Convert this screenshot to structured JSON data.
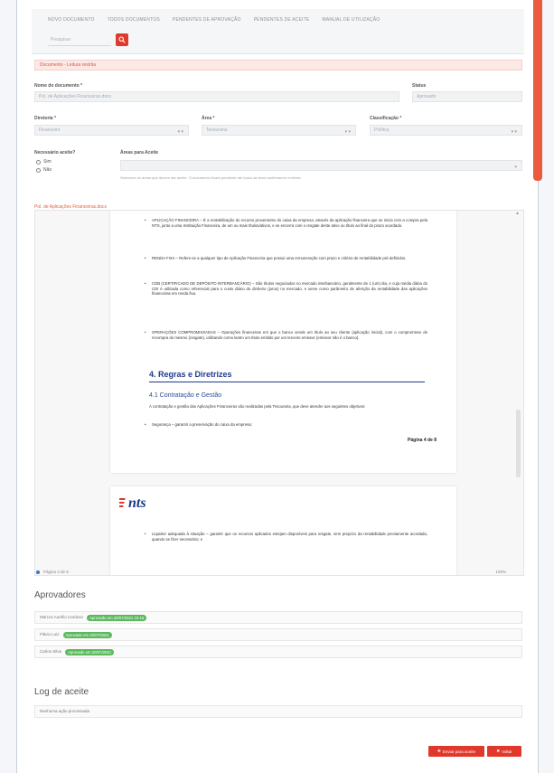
{
  "topnav": {
    "tabs": [
      "Novo documento",
      "Todos documentos",
      "Pendentes de aprovação",
      "Pendentes de aceite",
      "Manual de utilização"
    ],
    "search_placeholder": "Pesquisar"
  },
  "alert": "Documento - Leitura restrita",
  "form": {
    "doc_name_label": "Nome do documento *",
    "doc_name_value": "Pol. de Aplicações Financeiras.docx",
    "status_label": "Status",
    "status_value": "Aprovado",
    "diretoria_label": "Diretoria *",
    "diretoria_value": "Financeiro",
    "area_label": "Área *",
    "area_value": "Tesouraria",
    "class_label": "Classificação *",
    "class_value": "Política",
    "aceite_label": "Necessário aceite?",
    "sim_label": "Sim",
    "nao_label": "Não",
    "areas_aceite_label": "Áreas para Aceite",
    "hint": "Selecione as áreas que devem dar aceite. O documento ficará pendente até todos da área confirmarem a leitura."
  },
  "document": {
    "file_link": "Pol. de Aplicações Financeiras.docx",
    "bullets_p1": [
      "APLICAÇÃO FINANCEIRA – É a rentabilização do recurso proveniente do caixa da empresa, através da aplicação financeira que se inicia com a compra pela NTS, junto a uma Instituição Financeira, de um ou mais títulos/ativos, e se encerra com o resgate deste ativo ou título ao final do prazo acordado.",
      "RENDA FIXA – Refere-se a qualquer tipo de Aplicação Financeira que possui uma remuneração com prazo e critério de rentabilidade pré-definidos.",
      "CDB (CERTIFICADO DE DEPÓSITO INTERBANCÁRIO) – São títulos negociados no mercado interbancário, geralmente de 1 (um) dia, e cuja média diária do CDI é utilizada como referencial para o custo diário do dinheiro (juros) no mercado, e serve como parâmetro de aferição da rentabilidade das aplicações financeiras em renda fixa.",
      "OPERAÇÕES COMPROMISSADAS – Operações financeiras em que o banco vende um título ao seu cliente (aplicação inicial), com o compromisso de recompra do mesmo (resgate), utilizando como lastro um título emitido por um terceiro emissor (emissor não é o banco)."
    ],
    "heading": "4. Regras e Diretrizes",
    "subheading": "4.1 Contratação e Gestão",
    "para": "A contratação e gestão das Aplicações Financeiras são realizadas pela Tesouraria, que deve atender aos seguintes objetivos:",
    "bullet_short": "Segurança – garantir a preservação do caixa da empresa;",
    "page_num": "Página 4 de 8",
    "logo_text": "nts",
    "bullet_p2": "Liquidez adequada à situação – garantir que os recursos aplicados estejam disponíveis para resgate, sem prejuízo da rentabilidade previamente acordada, quando se fizer necessário; e"
  },
  "viewer_toolbar": {
    "left": "Página 4 de 8",
    "right": "100%"
  },
  "aprovadores": {
    "title": "Aprovadores",
    "rows": [
      {
        "name": "Marcos Aurélio Cardoso",
        "badge": "Aprovado em 20/07/2021 10:15"
      },
      {
        "name": "Flávio Luiz",
        "badge": "Aprovado em 20/07/2021"
      },
      {
        "name": "Carlos Silva",
        "badge": "Aprovado em 20/07/2021"
      }
    ]
  },
  "log": {
    "title": "Log de aceite",
    "empty": "Nenhuma ação processada"
  },
  "actions": {
    "primary": "Enviar para aceite",
    "secondary": "Voltar"
  }
}
